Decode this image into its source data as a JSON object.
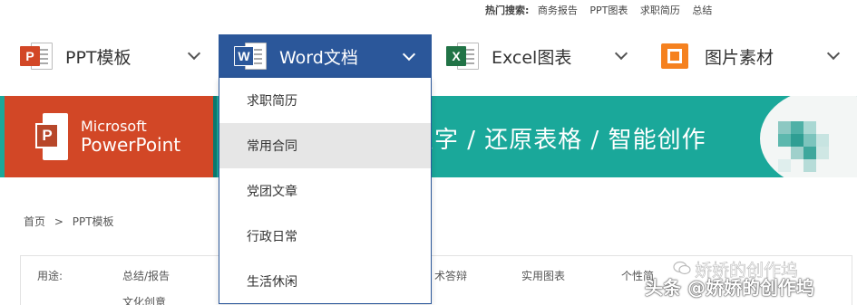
{
  "hot_search": {
    "label": "热门搜索:",
    "links": [
      "商务报告",
      "PPT图表",
      "求职简历",
      "总结"
    ]
  },
  "nav": {
    "items": [
      {
        "label": "PPT模板",
        "icon": "powerpoint-icon",
        "color": "#d24726",
        "badge": "P"
      },
      {
        "label": "Word文档",
        "icon": "word-icon",
        "color": "#2b579a",
        "badge": "W",
        "active": true
      },
      {
        "label": "Excel图表",
        "icon": "excel-icon",
        "color": "#217346",
        "badge": "X"
      },
      {
        "label": "图片素材",
        "icon": "image-icon",
        "color": "#f5811f",
        "badge": ""
      }
    ]
  },
  "dropdown": {
    "items": [
      "求职简历",
      "常用合同",
      "党团文章",
      "行政日常",
      "生活休闲"
    ],
    "hovered_index": 1
  },
  "banner": {
    "product_prefix": "Microsoft",
    "product_name": "PowerPoint",
    "slogan": "识字 / 还原表格 / 智能创作"
  },
  "breadcrumb": {
    "home": "首页",
    "separator": ">",
    "current": "PPT模板"
  },
  "filter": {
    "label": "用途:",
    "options": [
      "总结/报告",
      "文化创意",
      "术答辩",
      "实用图表",
      "个性简"
    ]
  },
  "watermark": {
    "line1": "娇娇的创作坞",
    "line2": "头条 @娇娇的创作坞"
  },
  "colors": {
    "word_blue": "#2b579a",
    "ppt_orange": "#d24726",
    "banner_teal": "#1aa89a",
    "excel_green": "#217346"
  }
}
